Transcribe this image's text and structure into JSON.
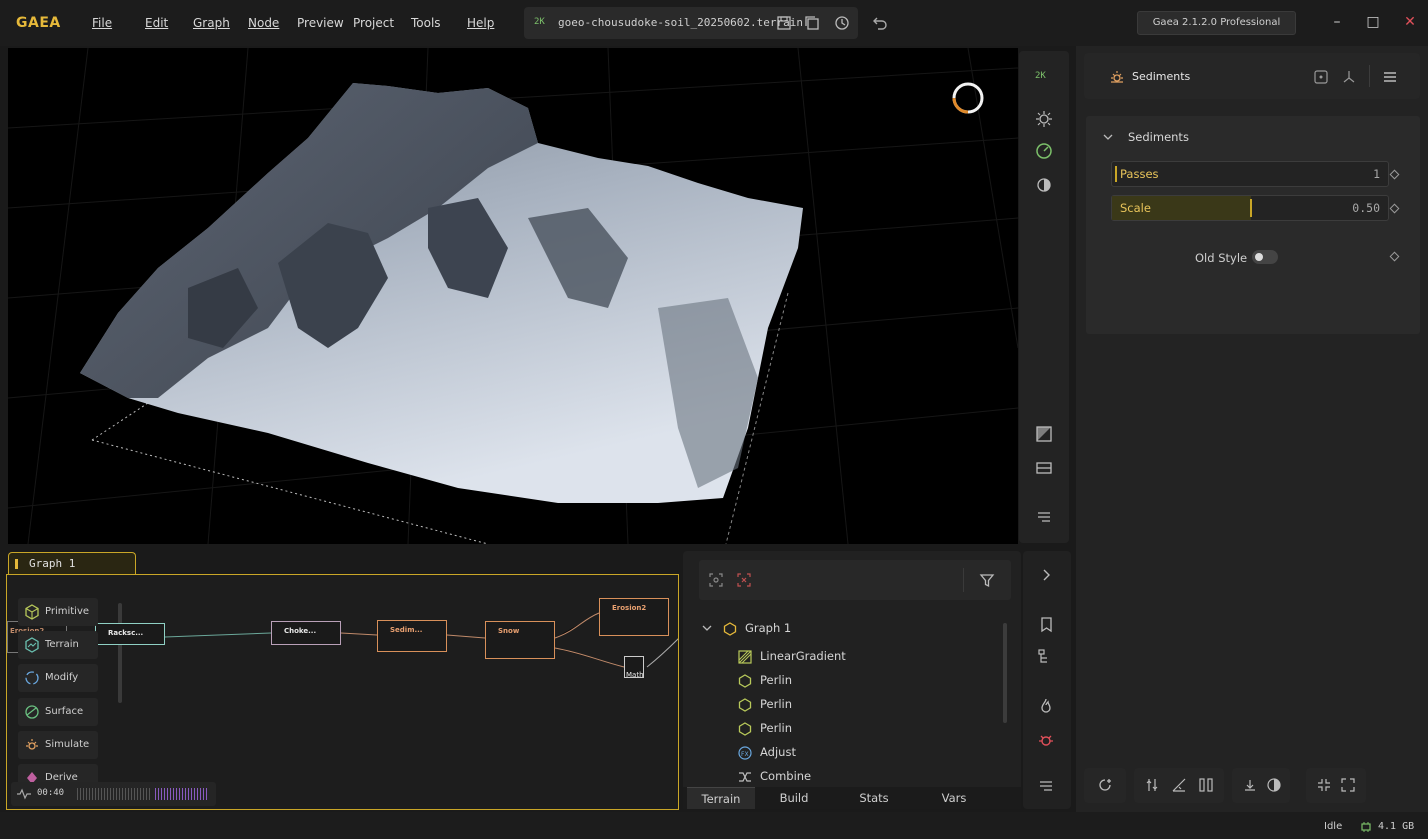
{
  "app": {
    "logo": "GAEA",
    "menu": [
      "File",
      "Edit",
      "Graph",
      "Node",
      "Preview",
      "Project",
      "Tools",
      "Help"
    ],
    "resolution_chip": "2K",
    "filename": "goeo-chousudoke-soil_20250602.terrain",
    "version": "Gaea 2.1.2.0 Professional"
  },
  "viewport": {
    "resolution_chip": "2K"
  },
  "graph": {
    "tab_label": "Graph 1",
    "palette": [
      "Primitive",
      "Terrain",
      "Modify",
      "Surface",
      "Simulate",
      "Derive"
    ],
    "nodes": {
      "erosion_left": "Erosion2",
      "rocksc": "Racksc...",
      "choke": "Choke...",
      "sedim": "Sedim...",
      "snow": "Snow",
      "erosion2": "Erosion2",
      "math": "Math"
    },
    "time": "00:40"
  },
  "tree": {
    "root": "Graph 1",
    "items": [
      "LinearGradient",
      "Perlin",
      "Perlin",
      "Perlin",
      "Adjust",
      "Combine"
    ],
    "tabs": [
      "Terrain",
      "Build",
      "Stats",
      "Vars"
    ],
    "active_tab": "Terrain"
  },
  "properties": {
    "node_title": "Sediments",
    "section_title": "Sediments",
    "passes_label": "Passes",
    "passes_value": "1",
    "scale_label": "Scale",
    "scale_value": "0.50",
    "old_style_label": "Old Style"
  },
  "status": {
    "state": "Idle",
    "memory": "4.1 GB"
  },
  "colors": {
    "accent": "#c9a627",
    "success": "#7cc06a",
    "danger": "#e0505a"
  }
}
